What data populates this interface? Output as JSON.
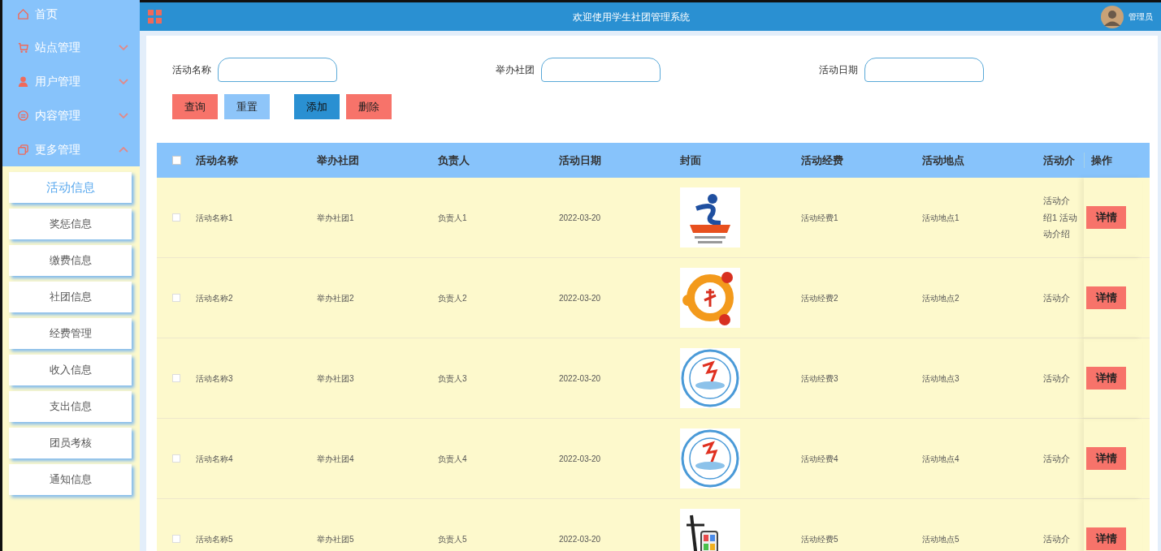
{
  "header": {
    "title": "欢迎使用学生社团管理系统",
    "user": "管理员"
  },
  "sidebar": {
    "items": [
      {
        "label": "首页"
      },
      {
        "label": "站点管理",
        "expanded": false
      },
      {
        "label": "用户管理",
        "expanded": false
      },
      {
        "label": "内容管理",
        "expanded": false
      },
      {
        "label": "更多管理",
        "expanded": true,
        "children": [
          {
            "label": "活动信息",
            "selected": true
          },
          {
            "label": "奖惩信息",
            "selected": false
          },
          {
            "label": "缴费信息",
            "selected": false
          },
          {
            "label": "社团信息",
            "selected": false
          },
          {
            "label": "经费管理",
            "selected": false
          },
          {
            "label": "收入信息",
            "selected": false
          },
          {
            "label": "支出信息",
            "selected": false
          },
          {
            "label": "团员考核",
            "selected": false
          },
          {
            "label": "通知信息",
            "selected": false
          }
        ]
      }
    ]
  },
  "search": {
    "fields": [
      {
        "label": "活动名称"
      },
      {
        "label": "举办社团"
      },
      {
        "label": "活动日期"
      }
    ],
    "buttons": [
      {
        "label": "查询",
        "kind": "danger"
      },
      {
        "label": "重置",
        "kind": "light"
      },
      {
        "label": "添加",
        "kind": "primary"
      },
      {
        "label": "删除",
        "kind": "danger"
      }
    ]
  },
  "table": {
    "columns": [
      "活动名称",
      "举办社团",
      "负责人",
      "活动日期",
      "封面",
      "活动经费",
      "活动地点",
      "活动介",
      "操作"
    ],
    "all_checked": false,
    "rows": [
      {
        "checked": false,
        "name": "活动名称1",
        "club": "举办社团1",
        "leader": "负责人1",
        "date": "2022-03-20",
        "cover": {
          "kind": "picture"
        },
        "funds": "活动经费1",
        "place": "活动地点1",
        "intro": [
          "活动介",
          "绍1 活动",
          "动介绍"
        ],
        "action": "详情"
      },
      {
        "checked": false,
        "name": "活动名称2",
        "club": "举办社团2",
        "leader": "负责人2",
        "date": "2022-03-20",
        "cover": {
          "kind": "picture"
        },
        "funds": "活动经费2",
        "place": "活动地点2",
        "intro": [
          "活动介"
        ],
        "action": "详情"
      },
      {
        "checked": false,
        "name": "活动名称3",
        "club": "举办社团3",
        "leader": "负责人3",
        "date": "2022-03-20",
        "cover": {
          "kind": "picture"
        },
        "funds": "活动经费3",
        "place": "活动地点3",
        "intro": [
          "活动介"
        ],
        "action": "详情"
      },
      {
        "checked": false,
        "name": "活动名称4",
        "club": "举办社团4",
        "leader": "负责人4",
        "date": "2022-03-20",
        "cover": {
          "kind": "picture"
        },
        "funds": "活动经费4",
        "place": "活动地点4",
        "intro": [
          "活动介"
        ],
        "action": "详情"
      },
      {
        "checked": false,
        "name": "活动名称5",
        "club": "举办社团5",
        "leader": "负责人5",
        "date": "2022-03-20",
        "cover": {
          "kind": "picture"
        },
        "funds": "活动经费5",
        "place": "活动地点5",
        "intro": [
          "活动介"
        ],
        "action": "详情"
      }
    ]
  }
}
